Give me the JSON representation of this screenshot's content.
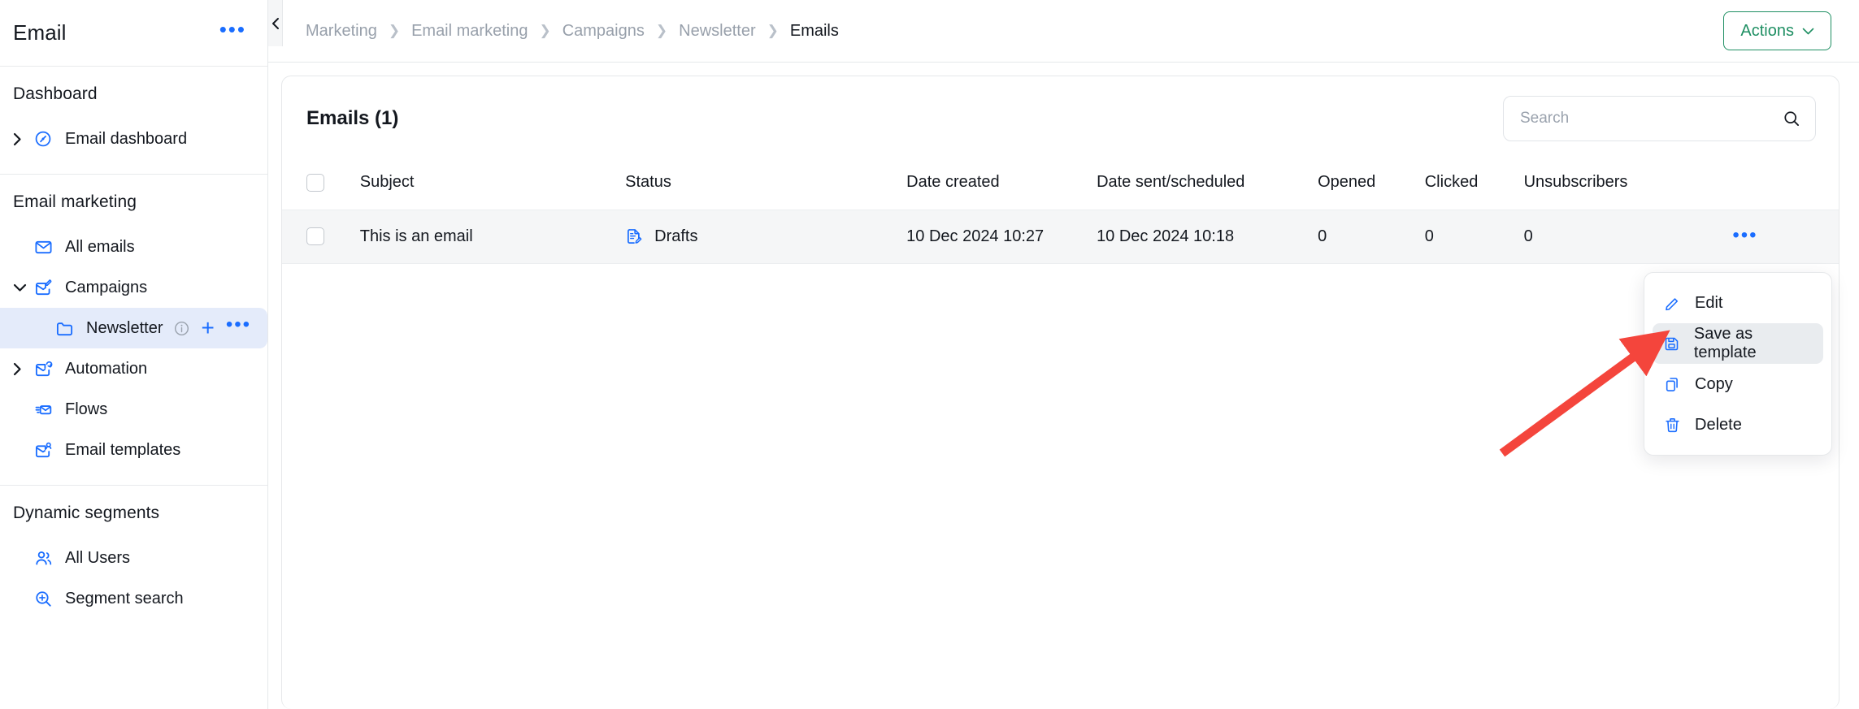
{
  "sidebar": {
    "title": "Email",
    "more_icon": "ellipsis-icon",
    "sections": [
      {
        "heading": "Dashboard",
        "items": [
          {
            "label": "Email dashboard",
            "icon": "dashboard-gauge-icon",
            "chevron": "right"
          }
        ]
      },
      {
        "heading": "Email marketing",
        "items": [
          {
            "label": "All emails",
            "icon": "envelope-icon",
            "chevron": ""
          },
          {
            "label": "Campaigns",
            "icon": "envelope-edit-icon",
            "chevron": "down"
          },
          {
            "label": "Newsletter",
            "icon": "folder-icon",
            "chevron": "",
            "active": true,
            "trailing": [
              "info-icon",
              "plus-icon",
              "ellipsis-icon"
            ]
          },
          {
            "label": "Automation",
            "icon": "envelope-refresh-icon",
            "chevron": "right"
          },
          {
            "label": "Flows",
            "icon": "flow-envelope-icon",
            "chevron": ""
          },
          {
            "label": "Email templates",
            "icon": "envelope-template-icon",
            "chevron": ""
          }
        ]
      },
      {
        "heading": "Dynamic segments",
        "items": [
          {
            "label": "All Users",
            "icon": "users-icon",
            "chevron": ""
          },
          {
            "label": "Segment search",
            "icon": "search-plus-icon",
            "chevron": ""
          }
        ]
      }
    ]
  },
  "topbar": {
    "collapse_icon": "chevron-left-icon",
    "breadcrumbs": [
      {
        "label": "Marketing",
        "current": false
      },
      {
        "label": "Email marketing",
        "current": false
      },
      {
        "label": "Campaigns",
        "current": false
      },
      {
        "label": "Newsletter",
        "current": false
      },
      {
        "label": "Emails",
        "current": true
      }
    ],
    "actions_label": "Actions",
    "actions_chevron": "chevron-down-icon"
  },
  "card": {
    "title": "Emails (1)",
    "search": {
      "placeholder": "Search",
      "value": "",
      "icon": "search-icon"
    },
    "columns": [
      "Subject",
      "Status",
      "Date created",
      "Date sent/scheduled",
      "Opened",
      "Clicked",
      "Unsubscribers"
    ],
    "rows": [
      {
        "subject": "This is an email",
        "status": "Drafts",
        "status_icon": "draft-document-icon",
        "date_created": "10 Dec 2024 10:27",
        "date_sent": "10 Dec 2024 10:18",
        "opened": "0",
        "clicked": "0",
        "unsubscribers": "0",
        "actions_icon": "ellipsis-icon"
      }
    ]
  },
  "context_menu": {
    "items": [
      {
        "label": "Edit",
        "icon": "pencil-icon",
        "highlighted": false
      },
      {
        "label": "Save as template",
        "icon": "save-floppy-icon",
        "highlighted": true
      },
      {
        "label": "Copy",
        "icon": "copy-icon",
        "highlighted": false
      },
      {
        "label": "Delete",
        "icon": "trash-icon",
        "highlighted": false
      }
    ]
  },
  "annotation": {
    "arrow_color": "#F4453C",
    "points_to": "Save as template"
  },
  "colors": {
    "accent_blue": "#1a6dff",
    "green": "#1f8f63",
    "active_item_bg": "#e4ebfa",
    "row_bg": "#f5f6f7",
    "menu_highlight": "#e9ecef"
  }
}
